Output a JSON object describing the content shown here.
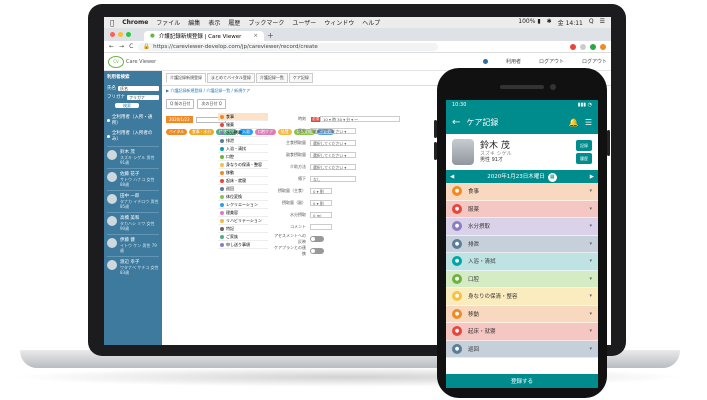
{
  "menubar": {
    "apple": "",
    "app": "Chrome",
    "menus": [
      "ファイル",
      "編集",
      "表示",
      "履歴",
      "ブックマーク",
      "ユーザー",
      "ウィンドウ",
      "ヘルプ"
    ],
    "status": [
      "100% ▮",
      "✱",
      "金 14:11",
      "Q",
      "☰"
    ]
  },
  "browser": {
    "tab_title": "介護記録新規登録 | Care Viewer",
    "new_tab": "+",
    "url": "https://careviewer-develop.com/jp/careviewer/record/create",
    "nav": [
      "←",
      "→",
      "C"
    ]
  },
  "app_header": {
    "logo_text": "Care Viewer",
    "items": [
      "利用者",
      "ログアウト",
      "ログアウト"
    ]
  },
  "sidebar": {
    "title": "利用者検索",
    "fields": [
      {
        "label": "氏名",
        "value": "氏名"
      },
      {
        "label": "フリガナ",
        "value": "フリガナ"
      }
    ],
    "search_button": "検索",
    "radios": [
      "全利用者（入所・通所）",
      "全利用者（入所者のみ）"
    ],
    "patients": [
      {
        "name": "鈴木 茂",
        "sub": "スズキ シゲル  男性 91歳"
      },
      {
        "name": "佐藤 花子",
        "sub": "サトウ ハナコ  女性 88歳"
      },
      {
        "name": "田中 一郎",
        "sub": "タナカ イチロウ  男性 85歳"
      },
      {
        "name": "高橋 美和",
        "sub": "タカハシ ミワ  女性 90歳"
      },
      {
        "name": "伊藤 健",
        "sub": "イトウ ケン  男性 79歳"
      },
      {
        "name": "渡辺 幸子",
        "sub": "ワタナベ サチコ  女性 83歳"
      }
    ]
  },
  "main": {
    "subtabs": [
      "介護記録新規登録",
      "まとめてバイタル登録",
      "介護記録一覧",
      "ケア記録"
    ],
    "crumb": "▶ 介護記録新規登録 / 介護記録一覧 / 新規ケア",
    "toolbar": [
      "Q 前の日付",
      "次の日付 Q"
    ],
    "date_label": "2020/1/23",
    "pills": [
      {
        "label": "バイタル",
        "color": "#f08a24"
      },
      {
        "label": "食事・水分",
        "color": "#f5a623"
      },
      {
        "label": "排泄記録",
        "color": "#4caf82"
      },
      {
        "label": "入浴",
        "color": "#2a9df4"
      },
      {
        "label": "口腔ケア",
        "color": "#e27ab8"
      },
      {
        "label": "処置",
        "color": "#f6b945"
      },
      {
        "label": "体位変換",
        "color": "#8bc34a"
      },
      {
        "label": "その他",
        "color": "#5c9bd6"
      }
    ],
    "categories": [
      {
        "label": "食事",
        "color": "#f08a24"
      },
      {
        "label": "服薬",
        "color": "#e8453c"
      },
      {
        "label": "水分摂取",
        "color": "#8e7cc3"
      },
      {
        "label": "排泄",
        "color": "#5a7d9a"
      },
      {
        "label": "入浴・清拭",
        "color": "#00a4a6"
      },
      {
        "label": "口腔",
        "color": "#6cb33f"
      },
      {
        "label": "身なりの保清・整容",
        "color": "#f5c242"
      },
      {
        "label": "移動",
        "color": "#f08a24"
      },
      {
        "label": "起床・就寝",
        "color": "#e8453c"
      },
      {
        "label": "巡回",
        "color": "#5a7d9a"
      },
      {
        "label": "体位変換",
        "color": "#8bc34a"
      },
      {
        "label": "レクリエーション",
        "color": "#2a9df4"
      },
      {
        "label": "理美容",
        "color": "#e27ab8"
      },
      {
        "label": "リハビリテーション",
        "color": "#f6b945"
      },
      {
        "label": "特記",
        "color": "#666666"
      },
      {
        "label": "ご家族",
        "color": "#4caf82"
      },
      {
        "label": "申し送り事項",
        "color": "#8e7cc3"
      }
    ],
    "form": [
      {
        "label": "時刻",
        "value": "10 ▾ 時 30 ▾ 分  ▾  ～"
      },
      {
        "label": "区分",
        "value": "選択してください ▾"
      },
      {
        "label": "主食摂取量",
        "value": "選択してください ▾"
      },
      {
        "label": "副食摂取量",
        "value": "選択してください ▾"
      },
      {
        "label": "介助方法",
        "value": "選択してください ▾"
      },
      {
        "label": "嚥下",
        "value": "なし"
      },
      {
        "label": "摂取量（主食）",
        "value": "0 ▾ 割"
      },
      {
        "label": "摂取量（副）",
        "value": "0 ▾ 割"
      },
      {
        "label": "水分摂取",
        "value": "0  ml"
      },
      {
        "label": "コメント",
        "value": ""
      }
    ],
    "toggles": [
      "アセスメントへの反映",
      "ケアプランとの連携"
    ]
  },
  "phone": {
    "time": "10:30",
    "signal": "▮▮▮ ◔",
    "title": "ケア記録",
    "back": "←",
    "bell": "🔔",
    "menu": "☰",
    "resident_name": "鈴木 茂",
    "resident_kana": "スズキ シゲル",
    "resident_info": "男性 91才",
    "btn_vital": "記録",
    "btn_history": "履歴",
    "date": "2020年1月23日木曜日",
    "prev": "◀",
    "next": "▶",
    "categories": [
      {
        "label": "食事",
        "bg": "#f8d9bf",
        "ic": "#f08a24"
      },
      {
        "label": "服薬",
        "bg": "#f4c7c3",
        "ic": "#e8453c"
      },
      {
        "label": "水分摂取",
        "bg": "#d9d2e9",
        "ic": "#8e7cc3"
      },
      {
        "label": "排泄",
        "bg": "#c5d0da",
        "ic": "#5a7d9a"
      },
      {
        "label": "入浴・清拭",
        "bg": "#bfe3e3",
        "ic": "#00a4a6"
      },
      {
        "label": "口腔",
        "bg": "#d4ebc4",
        "ic": "#6cb33f"
      },
      {
        "label": "身なりの保清・整容",
        "bg": "#fbecbf",
        "ic": "#f5c242"
      },
      {
        "label": "移動",
        "bg": "#f8d9bf",
        "ic": "#f08a24"
      },
      {
        "label": "起床・就寝",
        "bg": "#f4c7c3",
        "ic": "#e8453c"
      },
      {
        "label": "巡回",
        "bg": "#c5d0da",
        "ic": "#5a7d9a"
      }
    ],
    "submit": "登録する"
  },
  "colors": {
    "teal": "#008b8d",
    "sidebar": "#3d7a9e",
    "accent": "#f08a24"
  }
}
